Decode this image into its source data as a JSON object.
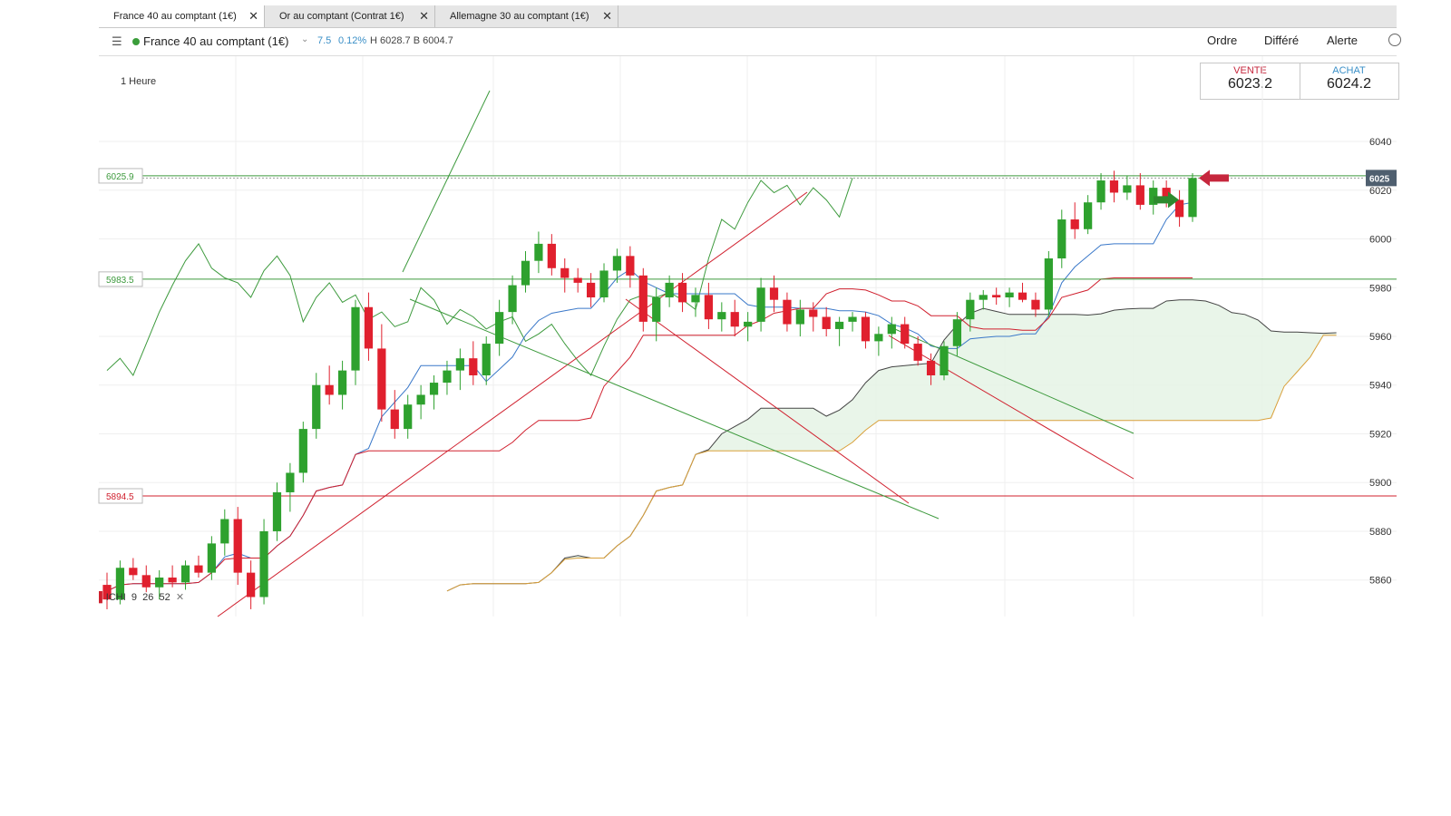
{
  "tabs": [
    {
      "label": "France 40 au comptant (1€)",
      "active": true
    },
    {
      "label": "Or au comptant (Contrat 1€)",
      "active": false
    },
    {
      "label": "Allemagne 30 au comptant (1€)",
      "active": false
    }
  ],
  "tab_close_glyph": "✕",
  "toolbar": {
    "menu_icon": "hamburger-icon",
    "instrument": "France 40 au comptant (1€)",
    "change": "7.5",
    "change_pct": "0.12%",
    "high_low": "H 6028.7  B 6004.7",
    "menu": [
      "Ordre",
      "Différé",
      "Alerte"
    ],
    "globe_icon": "globe-icon"
  },
  "timeframe": "1 Heure",
  "trade": {
    "sell_label": "VENTE",
    "sell_price": "6023.2",
    "buy_label": "ACHAT",
    "buy_price": "6024.2"
  },
  "price_labels": {
    "upper": "6025.9",
    "middle": "5983.5",
    "lower": "5894.5",
    "current": "6025"
  },
  "indicator": {
    "name": "ICHI",
    "params": [
      "9",
      "26",
      "52"
    ],
    "close_glyph": "✕"
  },
  "colors": {
    "bull": "#2ea12e",
    "bear": "#e0202e",
    "tenkan": "#3a78c9",
    "kijun": "#d0202e",
    "chikou": "#3d9a3d",
    "senkou_a": "#444444",
    "senkou_b": "#d9a03a",
    "cloud": "#e3f2e3",
    "cloud_bear": "#fbe4e4"
  },
  "chart_data": {
    "type": "candlestick",
    "timeframe": "1 Heure",
    "y_tick_labels": [
      "6040",
      "6020",
      "6000",
      "5980",
      "5960",
      "5940",
      "5920",
      "5900",
      "5880",
      "5860"
    ],
    "ylim": [
      5845,
      6075
    ],
    "horizontal_lines": [
      6025.9,
      5983.5,
      5894.5
    ],
    "last_price": 6025,
    "candles_ohlc": [
      [
        5858,
        5863,
        5848,
        5852
      ],
      [
        5852,
        5868,
        5850,
        5865
      ],
      [
        5865,
        5869,
        5860,
        5862
      ],
      [
        5862,
        5866,
        5855,
        5857
      ],
      [
        5857,
        5864,
        5852,
        5861
      ],
      [
        5861,
        5866,
        5857,
        5859
      ],
      [
        5859,
        5868,
        5856,
        5866
      ],
      [
        5866,
        5870,
        5861,
        5863
      ],
      [
        5863,
        5878,
        5860,
        5875
      ],
      [
        5875,
        5889,
        5870,
        5885
      ],
      [
        5885,
        5890,
        5858,
        5863
      ],
      [
        5863,
        5868,
        5848,
        5853
      ],
      [
        5853,
        5885,
        5850,
        5880
      ],
      [
        5880,
        5900,
        5876,
        5896
      ],
      [
        5896,
        5908,
        5888,
        5904
      ],
      [
        5904,
        5925,
        5900,
        5922
      ],
      [
        5922,
        5945,
        5918,
        5940
      ],
      [
        5940,
        5948,
        5932,
        5936
      ],
      [
        5936,
        5950,
        5930,
        5946
      ],
      [
        5946,
        5975,
        5940,
        5972
      ],
      [
        5972,
        5978,
        5950,
        5955
      ],
      [
        5955,
        5965,
        5925,
        5930
      ],
      [
        5930,
        5938,
        5918,
        5922
      ],
      [
        5922,
        5936,
        5918,
        5932
      ],
      [
        5932,
        5940,
        5926,
        5936
      ],
      [
        5936,
        5944,
        5930,
        5941
      ],
      [
        5941,
        5950,
        5936,
        5946
      ],
      [
        5946,
        5955,
        5938,
        5951
      ],
      [
        5951,
        5958,
        5940,
        5944
      ],
      [
        5944,
        5960,
        5940,
        5957
      ],
      [
        5957,
        5975,
        5952,
        5970
      ],
      [
        5970,
        5985,
        5965,
        5981
      ],
      [
        5981,
        5995,
        5978,
        5991
      ],
      [
        5991,
        6003,
        5986,
        5998
      ],
      [
        5998,
        6002,
        5985,
        5988
      ],
      [
        5988,
        5992,
        5978,
        5984
      ],
      [
        5984,
        5988,
        5978,
        5982
      ],
      [
        5982,
        5986,
        5972,
        5976
      ],
      [
        5976,
        5990,
        5974,
        5987
      ],
      [
        5987,
        5996,
        5982,
        5993
      ],
      [
        5993,
        5997,
        5980,
        5985
      ],
      [
        5985,
        5988,
        5962,
        5966
      ],
      [
        5966,
        5980,
        5958,
        5976
      ],
      [
        5976,
        5985,
        5972,
        5982
      ],
      [
        5982,
        5986,
        5970,
        5974
      ],
      [
        5974,
        5980,
        5968,
        5977
      ],
      [
        5977,
        5982,
        5963,
        5967
      ],
      [
        5967,
        5974,
        5962,
        5970
      ],
      [
        5970,
        5975,
        5960,
        5964
      ],
      [
        5964,
        5970,
        5958,
        5966
      ],
      [
        5966,
        5984,
        5962,
        5980
      ],
      [
        5980,
        5985,
        5970,
        5975
      ],
      [
        5975,
        5978,
        5962,
        5965
      ],
      [
        5965,
        5975,
        5960,
        5971
      ],
      [
        5971,
        5974,
        5962,
        5968
      ],
      [
        5968,
        5972,
        5960,
        5963
      ],
      [
        5963,
        5968,
        5956,
        5966
      ],
      [
        5966,
        5970,
        5962,
        5968
      ],
      [
        5968,
        5970,
        5955,
        5958
      ],
      [
        5958,
        5964,
        5952,
        5961
      ],
      [
        5961,
        5968,
        5955,
        5965
      ],
      [
        5965,
        5968,
        5955,
        5957
      ],
      [
        5957,
        5960,
        5948,
        5950
      ],
      [
        5950,
        5953,
        5940,
        5944
      ],
      [
        5944,
        5958,
        5942,
        5956
      ],
      [
        5956,
        5970,
        5952,
        5967
      ],
      [
        5967,
        5978,
        5962,
        5975
      ],
      [
        5975,
        5979,
        5971,
        5977
      ],
      [
        5977,
        5980,
        5973,
        5976
      ],
      [
        5976,
        5980,
        5972,
        5978
      ],
      [
        5978,
        5982,
        5974,
        5975
      ],
      [
        5975,
        5978,
        5968,
        5971
      ],
      [
        5971,
        5995,
        5968,
        5992
      ],
      [
        5992,
        6012,
        5988,
        6008
      ],
      [
        6008,
        6015,
        6000,
        6004
      ],
      [
        6004,
        6018,
        6002,
        6015
      ],
      [
        6015,
        6027,
        6012,
        6024
      ],
      [
        6024,
        6028,
        6015,
        6019
      ],
      [
        6019,
        6026,
        6016,
        6022
      ],
      [
        6022,
        6027,
        6012,
        6014
      ],
      [
        6014,
        6024,
        6010,
        6021
      ],
      [
        6021,
        6024,
        6013,
        6016
      ],
      [
        6016,
        6020,
        6005,
        6009
      ],
      [
        6009,
        6027,
        6007,
        6025
      ]
    ],
    "series": [
      {
        "name": "ICHI 9 26 52"
      }
    ]
  }
}
